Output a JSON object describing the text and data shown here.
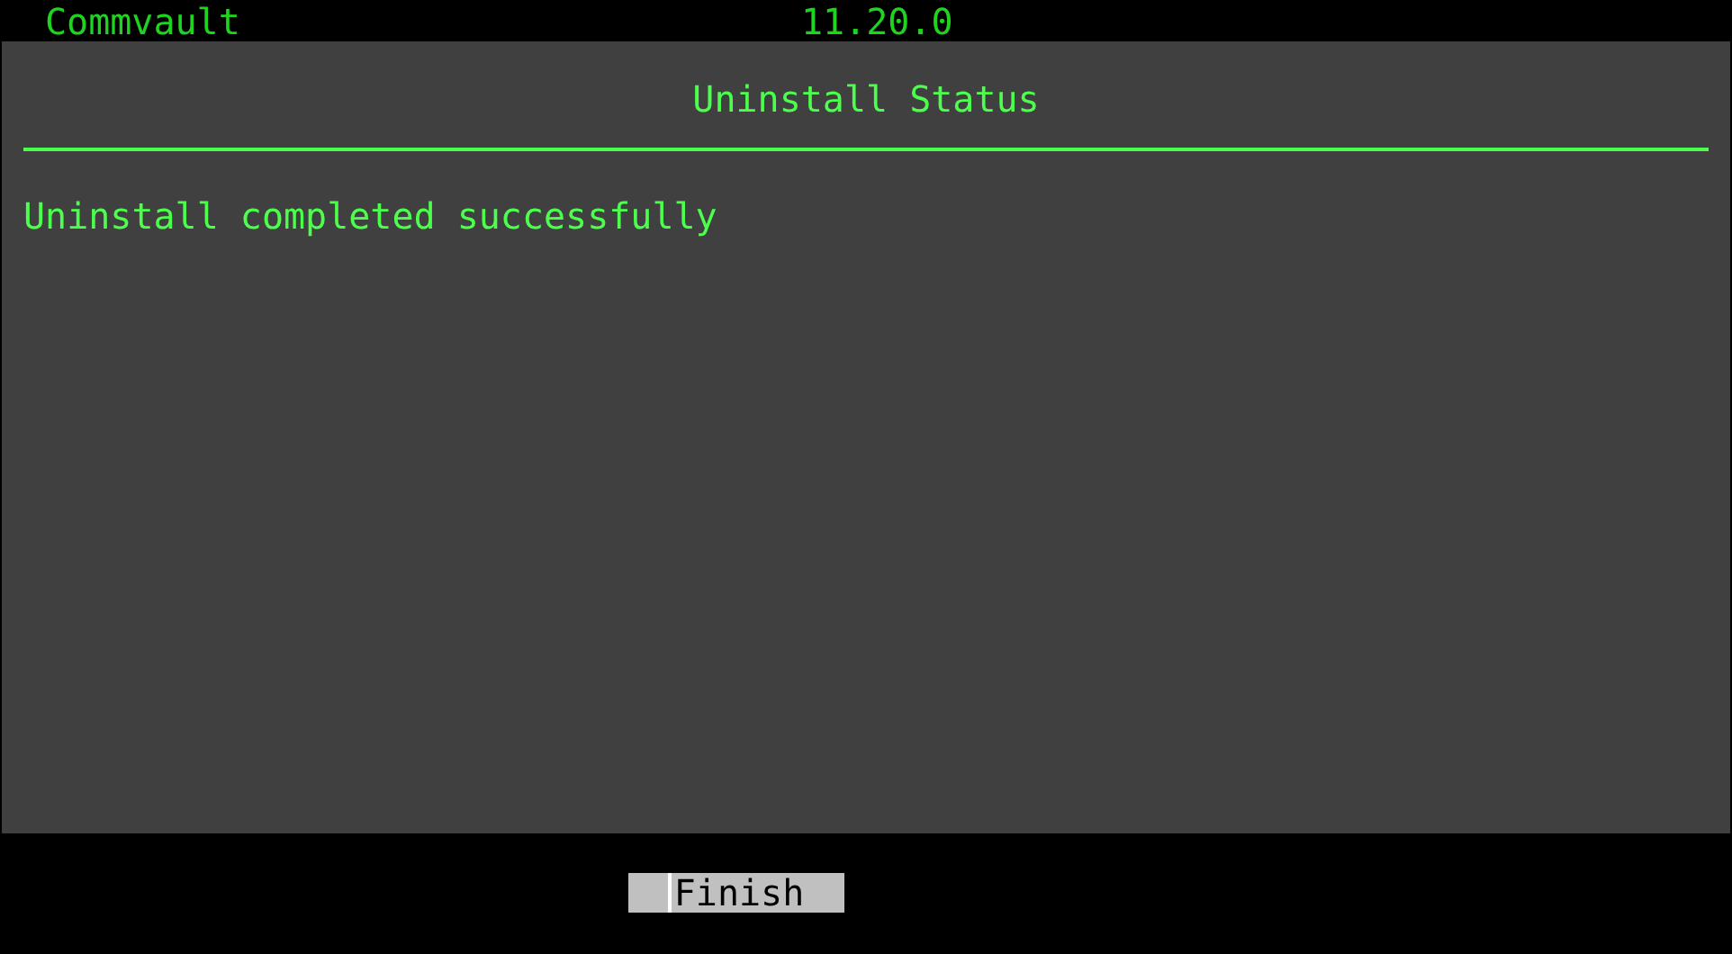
{
  "header": {
    "product": "Commvault",
    "version": "11.20.0"
  },
  "dialog": {
    "title": "Uninstall Status",
    "message": "Uninstall completed successfully"
  },
  "buttons": [
    {
      "label": "Finish",
      "focused": true
    }
  ]
}
